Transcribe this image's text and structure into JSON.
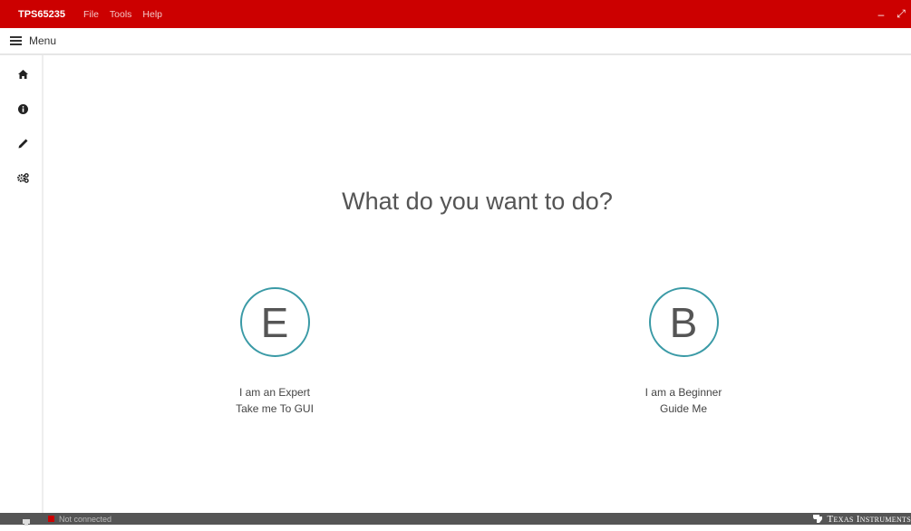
{
  "app": {
    "title": "TPS65235",
    "menus": [
      "File",
      "Tools",
      "Help"
    ],
    "window_controls": {
      "minimize": "–",
      "restore": "⤢"
    }
  },
  "menubar": {
    "label": "Menu"
  },
  "sidebar": {
    "items": [
      {
        "name": "home",
        "icon": "home-icon"
      },
      {
        "name": "info",
        "icon": "info-icon"
      },
      {
        "name": "edit",
        "icon": "pencil-icon"
      },
      {
        "name": "settings",
        "icon": "gears-icon"
      }
    ]
  },
  "main": {
    "headline": "What do you want to do?",
    "choices": [
      {
        "letter": "E",
        "line1": "I am an Expert",
        "line2": "Take me To GUI"
      },
      {
        "letter": "B",
        "line1": "I am a Beginner",
        "line2": "Guide Me"
      }
    ]
  },
  "status": {
    "text": "Not connected",
    "brand": "Texas Instruments",
    "colors": {
      "accent": "#cc0000",
      "circle": "#3a9aa6",
      "status_dot": "#cc0000"
    }
  }
}
